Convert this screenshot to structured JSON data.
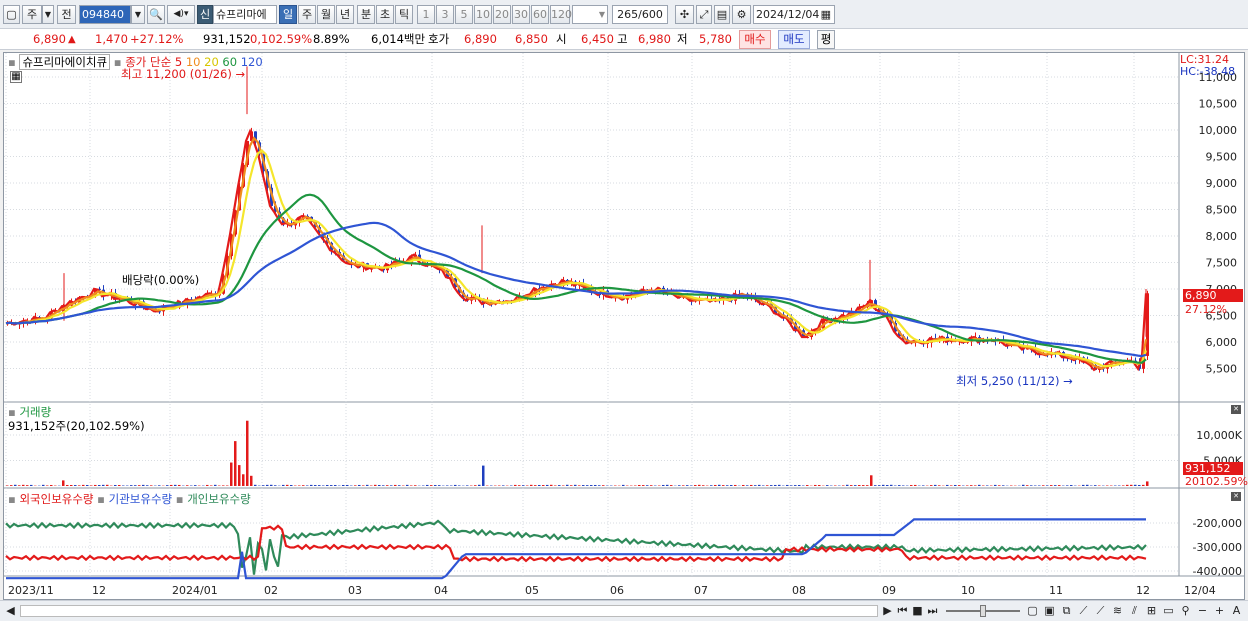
{
  "toolbar": {
    "market": "주",
    "prev": "전",
    "code": "094840",
    "new_badge": "신",
    "stock_name": "슈프리마에",
    "periods": [
      "일",
      "주",
      "월",
      "년",
      "분",
      "초",
      "틱"
    ],
    "intervals": [
      "1",
      "3",
      "5",
      "10",
      "20",
      "30",
      "60",
      "120"
    ],
    "count": "265",
    "count_max": "/600",
    "date": "2024/12/04"
  },
  "info": {
    "price": "6,890",
    "change": "1,470",
    "change_pct": "+27.12%",
    "volume": "931,152",
    "volume_ratio": "0,102.59%",
    "turnover": "8.89%",
    "amount": "6,014백만",
    "hoga_label": "호가",
    "hoga1": "6,890",
    "hoga2": "6,850",
    "open_label": "시",
    "open": "6,450",
    "high_label": "고",
    "high": "6,980",
    "low_label": "저",
    "low": "5,780",
    "buy": "매수",
    "sell": "매도",
    "eval": "평"
  },
  "price_panel": {
    "stock_label": "슈프리마에이치큐",
    "ma_title": "종가 단순",
    "ma_periods": [
      "5",
      "10",
      "20",
      "60",
      "120"
    ],
    "ma_colors": [
      "#e31a1a",
      "#f08c1e",
      "#f5e62c",
      "#1e9640",
      "#2f55d4"
    ],
    "lc": "LC:31.24",
    "hc": "HC:-38.48",
    "high_annotation": "최고 11,200 (01/26)",
    "low_annotation": "최저 5,250 (11/12)",
    "dividend_annotation": "배당락(0.00%)",
    "current_price_tag": "6,890",
    "current_pct_tag": "27.12%",
    "y_ticks": [
      "11,000",
      "10,500",
      "10,000",
      "9,500",
      "9,000",
      "8,500",
      "8,000",
      "7,500",
      "7,000",
      "6,500",
      "6,000",
      "5,500"
    ]
  },
  "volume_panel": {
    "title": "거래량",
    "subtitle": "931,152주(20,102.59%)",
    "y_ticks": [
      "10,000K",
      "5,000K"
    ],
    "current_tag": "931,152",
    "current_pct_tag": "20102.59%"
  },
  "holding_panel": {
    "legend": [
      "외국인보유수량",
      "기관보유수량",
      "개인보유수량"
    ],
    "y_ticks": [
      "-200,000",
      "-300,000",
      "-400,000"
    ]
  },
  "x_axis": [
    "2023/11",
    "12",
    "2024/01",
    "02",
    "03",
    "04",
    "05",
    "06",
    "07",
    "08",
    "09",
    "10",
    "11",
    "12",
    "12/04"
  ],
  "colors": {
    "up": "#e31a1a",
    "down": "#1f3fbf",
    "grid": "#d7dbe0"
  }
}
